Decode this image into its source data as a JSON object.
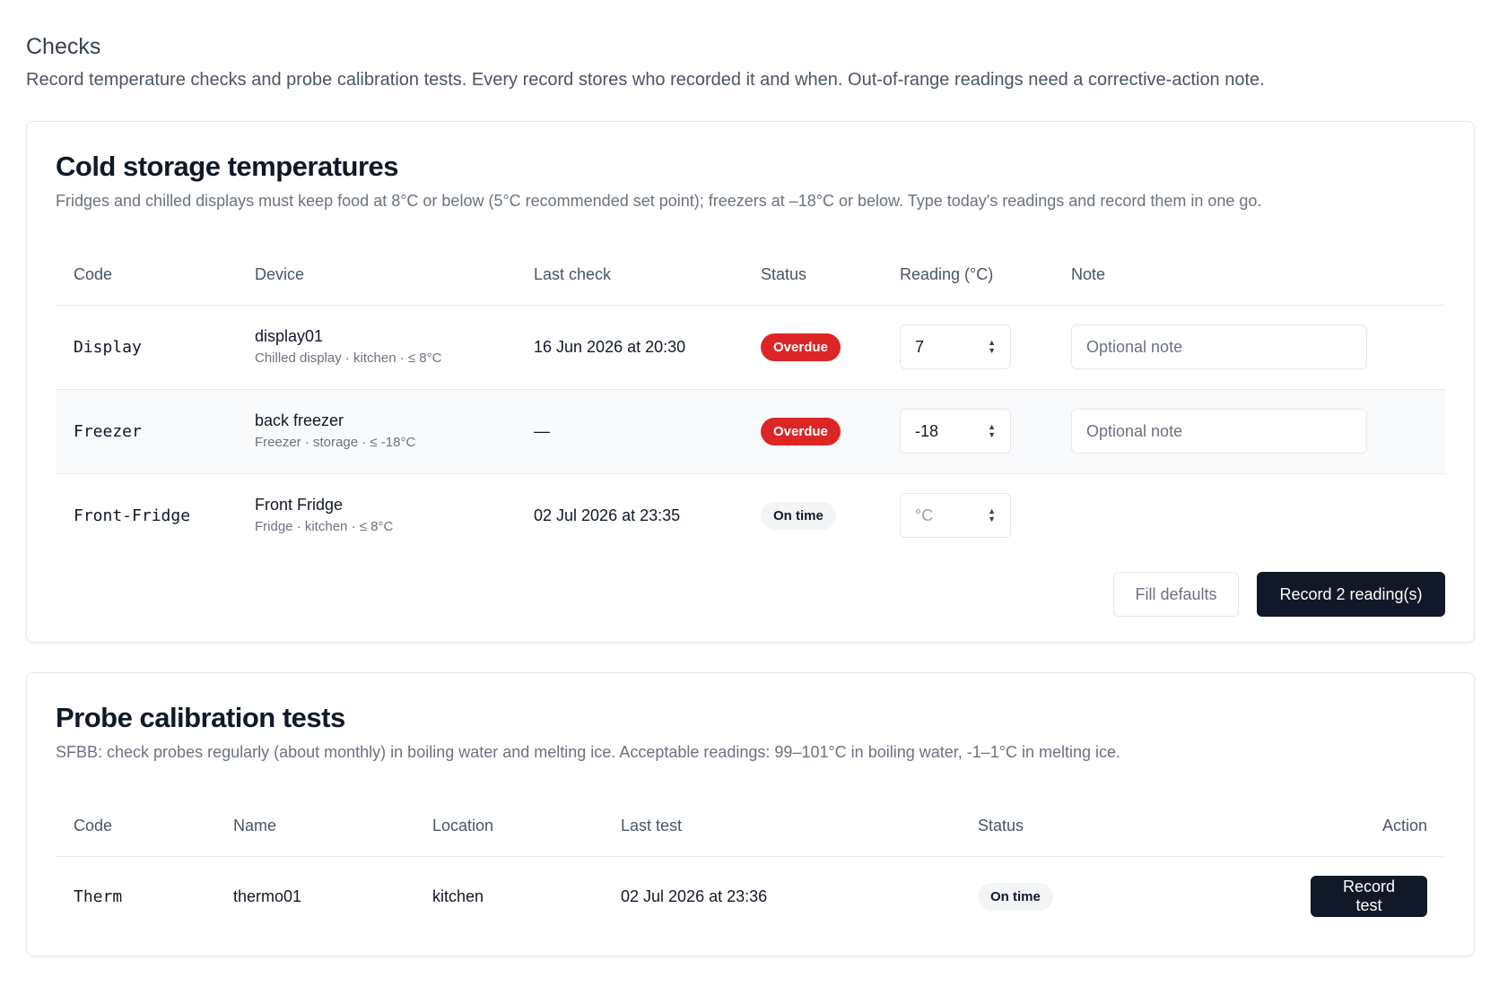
{
  "page": {
    "title": "Checks",
    "description": "Record temperature checks and probe calibration tests. Every record stores who recorded it and when. Out-of-range readings need a corrective-action note."
  },
  "cold_storage": {
    "title": "Cold storage temperatures",
    "description": "Fridges and chilled displays must keep food at 8°C or below (5°C recommended set point); freezers at –18°C or below. Type today's readings and record them in one go.",
    "columns": [
      "Code",
      "Device",
      "Last check",
      "Status",
      "Reading (°C)",
      "Note"
    ],
    "rows": [
      {
        "code": "Display",
        "device_name": "display01",
        "device_sub": "Chilled display · kitchen · ≤ 8°C",
        "last_check": "16 Jun 2026 at 20:30",
        "status": "Overdue",
        "reading": "7",
        "note_placeholder": "Optional note"
      },
      {
        "code": "Freezer",
        "device_name": "back freezer",
        "device_sub": "Freezer · storage · ≤ -18°C",
        "last_check": "—",
        "status": "Overdue",
        "reading": "-18",
        "note_placeholder": "Optional note"
      },
      {
        "code": "Front-Fridge",
        "device_name": "Front Fridge",
        "device_sub": "Fridge · kitchen · ≤ 8°C",
        "last_check": "02 Jul 2026 at 23:35",
        "status": "On time",
        "reading_placeholder": "°C"
      }
    ],
    "fill_defaults_label": "Fill defaults",
    "record_label": "Record 2 reading(s)"
  },
  "probe": {
    "title": "Probe calibration tests",
    "description": "SFBB: check probes regularly (about monthly) in boiling water and melting ice. Acceptable readings: 99–101°C in boiling water, -1–1°C in melting ice.",
    "columns": [
      "Code",
      "Name",
      "Location",
      "Last test",
      "Status",
      "Action"
    ],
    "rows": [
      {
        "code": "Therm",
        "name": "thermo01",
        "location": "kitchen",
        "last_test": "02 Jul 2026 at 23:36",
        "status": "On time",
        "action_label": "Record test"
      }
    ]
  },
  "colors": {
    "overdue": "#dc2626",
    "on_time_bg": "#f3f4f6",
    "primary_button": "#111827"
  }
}
